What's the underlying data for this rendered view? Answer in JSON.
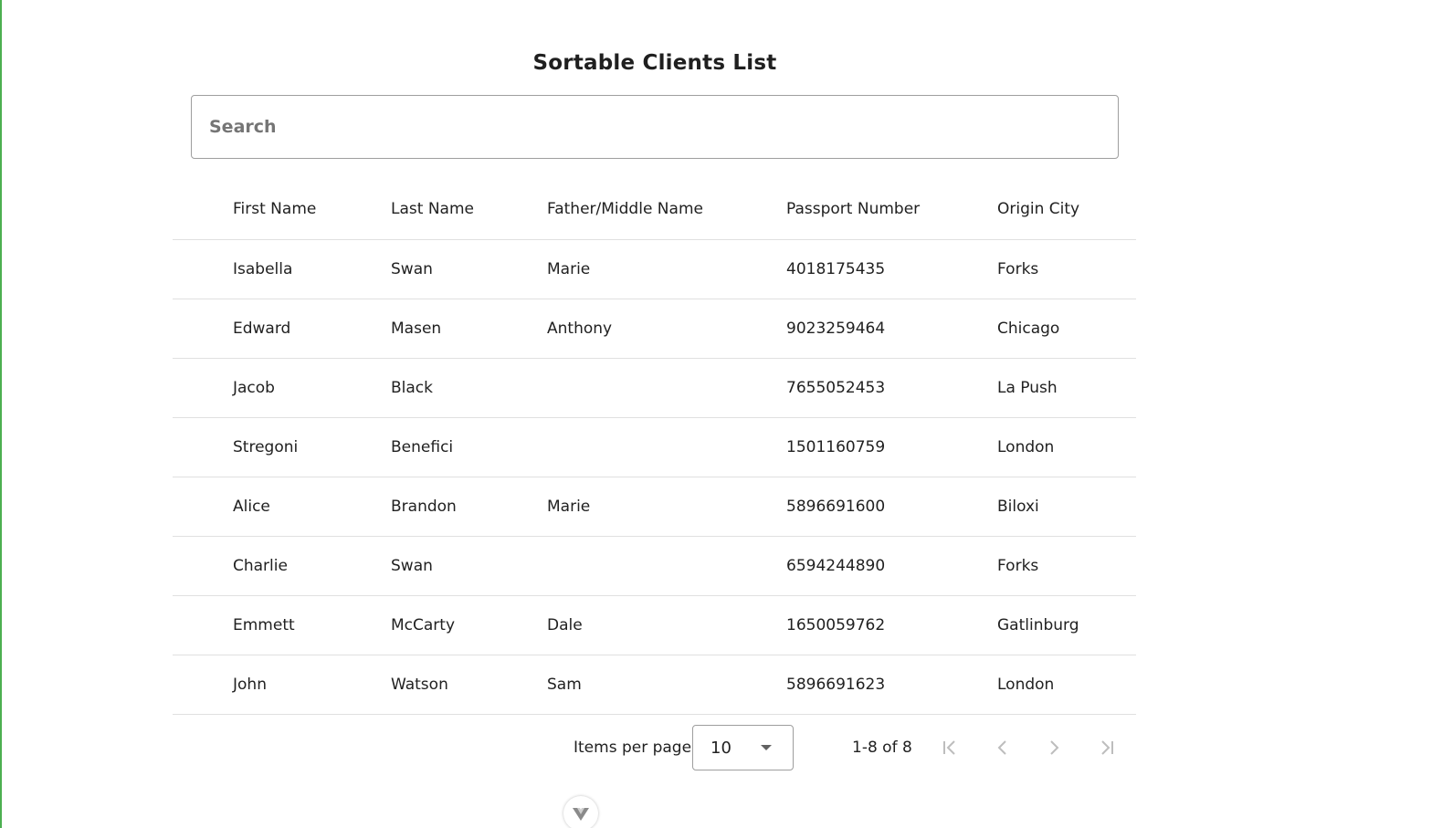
{
  "title": "Sortable Clients List",
  "search": {
    "placeholder": "Search",
    "value": ""
  },
  "table": {
    "columns": [
      "First Name",
      "Last Name",
      "Father/Middle Name",
      "Passport Number",
      "Origin City"
    ],
    "rows": [
      [
        "Isabella",
        "Swan",
        "Marie",
        "4018175435",
        "Forks"
      ],
      [
        "Edward",
        "Masen",
        "Anthony",
        "9023259464",
        "Chicago"
      ],
      [
        "Jacob",
        "Black",
        "",
        "7655052453",
        "La Push"
      ],
      [
        "Stregoni",
        "Benefici",
        "",
        "1501160759",
        "London"
      ],
      [
        "Alice",
        "Brandon",
        "Marie",
        "5896691600",
        "Biloxi"
      ],
      [
        "Charlie",
        "Swan",
        "",
        "6594244890",
        "Forks"
      ],
      [
        "Emmett",
        "McCarty",
        "Dale",
        "1650059762",
        "Gatlinburg"
      ],
      [
        "John",
        "Watson",
        "Sam",
        "5896691623",
        "London"
      ]
    ]
  },
  "paginator": {
    "items_per_page_label": "Items per page:",
    "items_per_page_value": "10",
    "range_label": "1-8 of 8",
    "buttons": {
      "first": "first-page-icon",
      "previous": "chevron-left-icon",
      "next": "chevron-right-icon",
      "last": "last-page-icon"
    }
  },
  "colors": {
    "accent_edge": "#4caf50",
    "text": "#212121",
    "divider": "#e0e0e0",
    "disabled_icon": "#bdbdbd"
  }
}
